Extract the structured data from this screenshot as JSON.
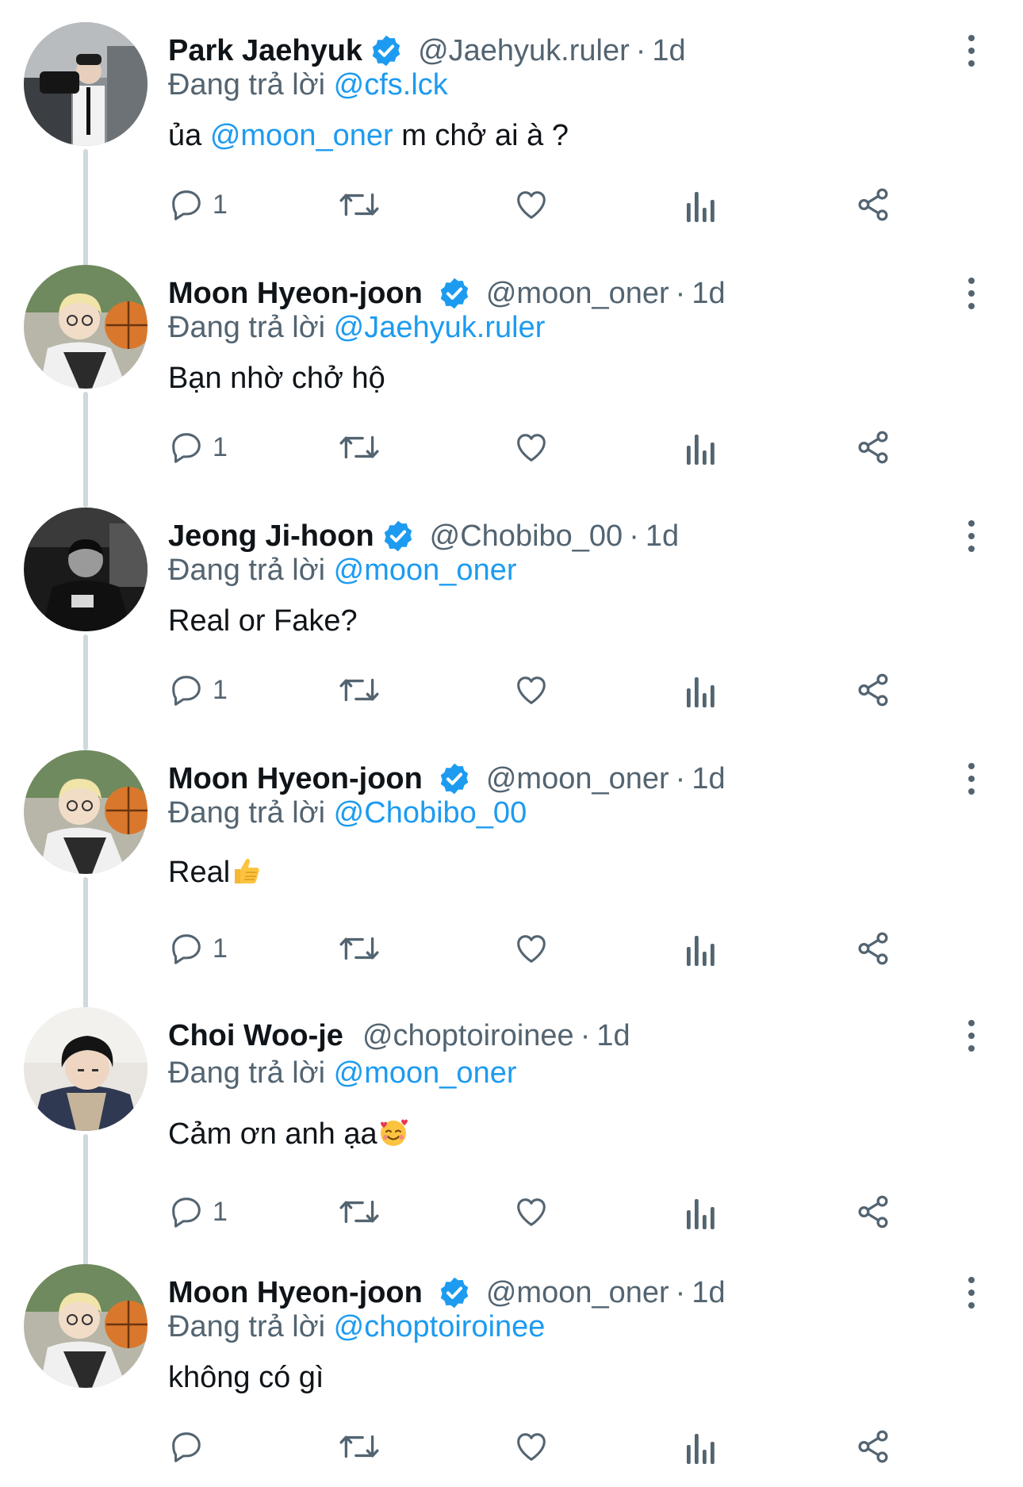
{
  "tweets": [
    {
      "name": "Park Jaehyuk",
      "verified": true,
      "handle": "@Jaehyuk.ruler",
      "time": "1d",
      "reply_prefix": "Đang trả lời",
      "reply_to": "@cfs.lck",
      "text_parts": [
        "ủa ",
        "@moon_oner",
        " m chở ai à ?"
      ],
      "reply_count": "1",
      "avatar": "avatar-photo-jaehyuk"
    },
    {
      "name": "Moon Hyeon-joon",
      "verified": true,
      "handle": "@moon_oner",
      "time": "1d",
      "reply_prefix": "Đang trả lời",
      "reply_to": "@Jaehyuk.ruler",
      "text": "Bạn nhờ chở hộ",
      "reply_count": "1",
      "avatar": "avatar-photo-moon"
    },
    {
      "name": "Jeong Ji-hoon",
      "verified": true,
      "handle": "@Chobibo_00",
      "time": "1d",
      "reply_prefix": "Đang trả lời",
      "reply_to": "@moon_oner",
      "text": "Real or Fake?",
      "reply_count": "1",
      "avatar": "avatar-photo-jihoon"
    },
    {
      "name": "Moon Hyeon-joon",
      "verified": true,
      "handle": "@moon_oner",
      "time": "1d",
      "reply_prefix": "Đang trả lời",
      "reply_to": "@Chobibo_00",
      "text": "Real",
      "emoji": "thumbs-up-emoji",
      "reply_count": "1",
      "avatar": "avatar-photo-moon"
    },
    {
      "name": "Choi Woo-je",
      "verified": false,
      "handle": "@choptoiroinee",
      "time": "1d",
      "reply_prefix": "Đang trả lời",
      "reply_to": "@moon_oner",
      "text": "Cảm ơn anh ạa",
      "emoji": "smiling-face-with-hearts-emoji",
      "reply_count": "1",
      "avatar": "avatar-photo-wooje"
    },
    {
      "name": "Moon Hyeon-joon",
      "verified": true,
      "handle": "@moon_oner",
      "time": "1d",
      "reply_prefix": "Đang trả lời",
      "reply_to": "@choptoiroinee",
      "text": "không có gì",
      "reply_count": "",
      "avatar": "avatar-photo-moon"
    }
  ],
  "separator": "·",
  "icons": {
    "reply": "reply-icon",
    "retweet": "retweet-icon",
    "like": "like-icon",
    "views": "views-icon",
    "share": "share-icon",
    "more": "more-icon",
    "verified": "verified-badge-icon"
  },
  "colors": {
    "mention": "#1d9bf0",
    "secondary_text": "#536471",
    "verified": "#1d9bf0",
    "thread_line": "#cfd9de"
  }
}
